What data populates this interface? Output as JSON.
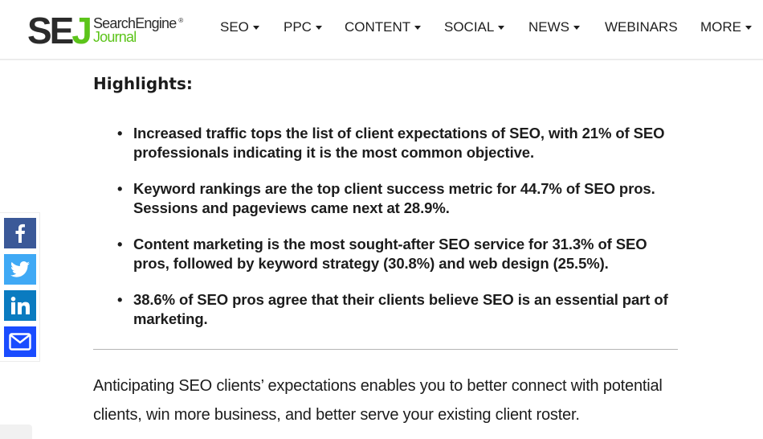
{
  "header": {
    "logo": {
      "mark_dark": "SE",
      "mark_accent": "J",
      "line1": "SearchEngine",
      "registered": "®",
      "line2": "Journal"
    },
    "nav": [
      {
        "label": "SEO",
        "dropdown": true
      },
      {
        "label": "PPC",
        "dropdown": true
      },
      {
        "label": "CONTENT",
        "dropdown": true
      },
      {
        "label": "SOCIAL",
        "dropdown": true
      },
      {
        "label": "NEWS",
        "dropdown": true
      },
      {
        "label": "WEBINARS",
        "dropdown": false
      },
      {
        "label": "MORE",
        "dropdown": true
      }
    ]
  },
  "share": {
    "buttons": [
      {
        "network": "facebook",
        "icon": "facebook-icon",
        "color": "#3b5998"
      },
      {
        "network": "twitter",
        "icon": "twitter-icon",
        "color": "#3fa9f5"
      },
      {
        "network": "linkedin",
        "icon": "linkedin-icon",
        "color": "#0a7bc0"
      },
      {
        "network": "email",
        "icon": "envelope-icon",
        "color": "#1a4cff"
      }
    ]
  },
  "article": {
    "highlights_title": "Highlights:",
    "highlights": [
      "Increased traffic tops the list of client expectations of SEO, with 21% of SEO professionals indicating it is the most common objective.",
      "Keyword rankings are the top client success metric for 44.7% of SEO pros. Sessions and pageviews came next at 28.9%.",
      "Content marketing is the most sought-after SEO service for 31.3% of SEO pros, followed by keyword strategy (30.8%) and web design (25.5%).",
      "38.6% of SEO pros agree that their clients believe SEO is an essential part of marketing."
    ],
    "paragraph": "Anticipating SEO clients’ expectations enables you to better connect with potential clients, win more business, and better serve your existing client roster."
  },
  "colors": {
    "brand_green": "#5cc41a",
    "text": "#1c1c1c"
  }
}
